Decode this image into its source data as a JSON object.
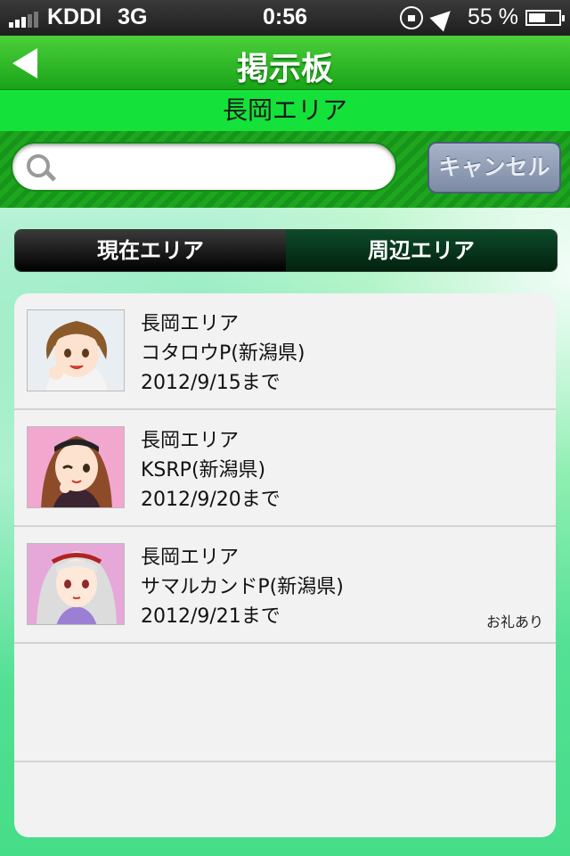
{
  "status_bar": {
    "carrier": "KDDI",
    "network": "3G",
    "time": "0:56",
    "battery": "55 %",
    "battery_level": 0.55
  },
  "nav": {
    "title": "掲示板"
  },
  "area_bar": {
    "label": "長岡エリア"
  },
  "search": {
    "placeholder": "",
    "value": "",
    "cancel_label": "キャンセル"
  },
  "tabs": [
    {
      "label": "現在エリア",
      "active": true
    },
    {
      "label": "周辺エリア",
      "active": false
    }
  ],
  "posts": [
    {
      "area": "長岡エリア",
      "author": "コタロウP(新潟県)",
      "until": "2012/9/15まで",
      "badge": "",
      "avatar": "brown-short-hair-character"
    },
    {
      "area": "長岡エリア",
      "author": "KSRP(新潟県)",
      "until": "2012/9/20まで",
      "badge": "",
      "avatar": "brown-long-hair-character"
    },
    {
      "area": "長岡エリア",
      "author": "サマルカンドP(新潟県)",
      "until": "2012/9/21まで",
      "badge": "お礼あり",
      "avatar": "silver-hair-character"
    }
  ]
}
